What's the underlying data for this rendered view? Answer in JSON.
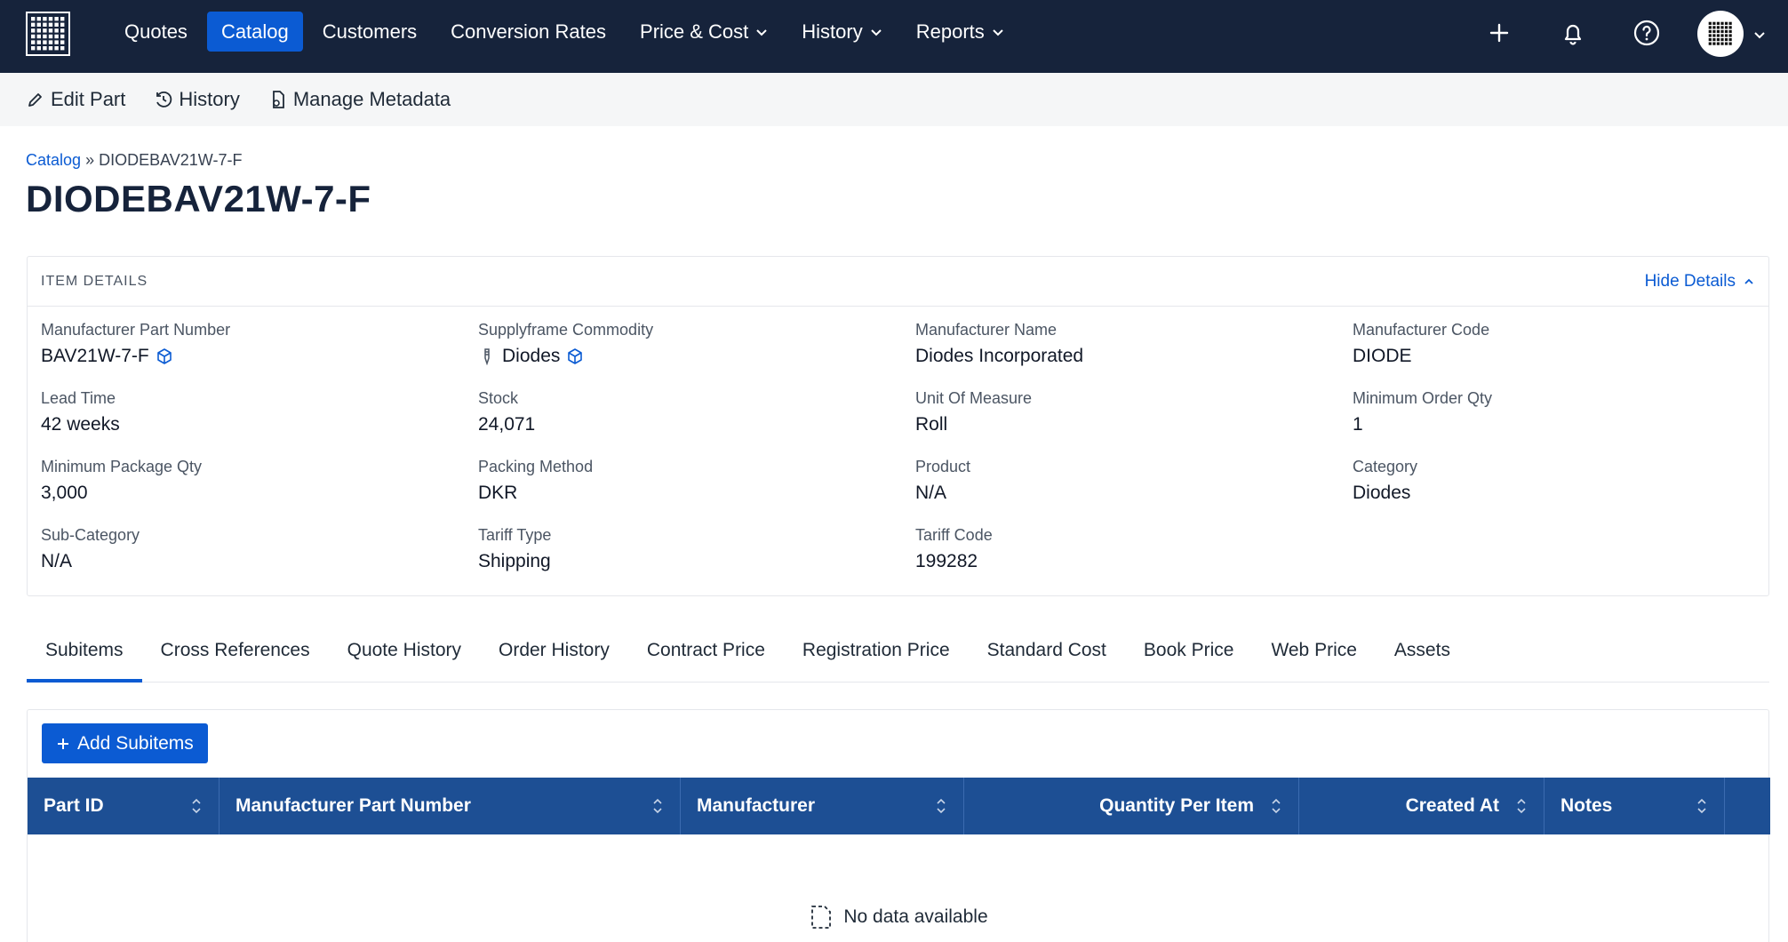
{
  "nav": {
    "items": [
      {
        "label": "Quotes",
        "active": false,
        "dropdown": false
      },
      {
        "label": "Catalog",
        "active": true,
        "dropdown": false
      },
      {
        "label": "Customers",
        "active": false,
        "dropdown": false
      },
      {
        "label": "Conversion Rates",
        "active": false,
        "dropdown": false
      },
      {
        "label": "Price & Cost",
        "active": false,
        "dropdown": true
      },
      {
        "label": "History",
        "active": false,
        "dropdown": true
      },
      {
        "label": "Reports",
        "active": false,
        "dropdown": true
      }
    ],
    "icons": [
      "plus-icon",
      "bell-icon",
      "help-icon",
      "avatar"
    ]
  },
  "toolbar": {
    "edit_label": "Edit Part",
    "history_label": "History",
    "metadata_label": "Manage Metadata"
  },
  "breadcrumb": {
    "root": "Catalog",
    "sep": "»",
    "current": "DIODEBAV21W-7-F"
  },
  "page": {
    "title": "DIODEBAV21W-7-F"
  },
  "details": {
    "header": "ITEM DETAILS",
    "hide_label": "Hide Details",
    "fields": [
      {
        "key": "Manufacturer Part Number",
        "value": "BAV21W-7-F",
        "icon_after": "cube-icon"
      },
      {
        "key": "Supplyframe Commodity",
        "value": "Diodes",
        "icon_before": "component-icon",
        "icon_after": "cube-icon"
      },
      {
        "key": "Manufacturer Name",
        "value": "Diodes Incorporated"
      },
      {
        "key": "Manufacturer Code",
        "value": "DIODE"
      },
      {
        "key": "Lead Time",
        "value": "42 weeks"
      },
      {
        "key": "Stock",
        "value": "24,071"
      },
      {
        "key": "Unit Of Measure",
        "value": "Roll"
      },
      {
        "key": "Minimum Order Qty",
        "value": "1"
      },
      {
        "key": "Minimum Package Qty",
        "value": "3,000"
      },
      {
        "key": "Packing Method",
        "value": "DKR"
      },
      {
        "key": "Product",
        "value": "N/A"
      },
      {
        "key": "Category",
        "value": "Diodes"
      },
      {
        "key": "Sub-Category",
        "value": "N/A"
      },
      {
        "key": "Tariff Type",
        "value": "Shipping"
      },
      {
        "key": "Tariff Code",
        "value": "199282"
      }
    ]
  },
  "tabs": [
    {
      "label": "Subitems",
      "active": true
    },
    {
      "label": "Cross References",
      "active": false
    },
    {
      "label": "Quote History",
      "active": false
    },
    {
      "label": "Order History",
      "active": false
    },
    {
      "label": "Contract Price",
      "active": false
    },
    {
      "label": "Registration Price",
      "active": false
    },
    {
      "label": "Standard Cost",
      "active": false
    },
    {
      "label": "Book Price",
      "active": false
    },
    {
      "label": "Web Price",
      "active": false
    },
    {
      "label": "Assets",
      "active": false
    }
  ],
  "subitems": {
    "add_label": "Add Subitems",
    "columns": [
      {
        "label": "Part ID",
        "align": "left"
      },
      {
        "label": "Manufacturer Part Number",
        "align": "left"
      },
      {
        "label": "Manufacturer",
        "align": "left"
      },
      {
        "label": "Quantity Per Item",
        "align": "right"
      },
      {
        "label": "Created At",
        "align": "right"
      },
      {
        "label": "Notes",
        "align": "left"
      },
      {
        "label": "",
        "align": "left"
      }
    ],
    "empty_text": "No data available"
  },
  "colors": {
    "nav_bg": "#16233b",
    "accent": "#0b5bd3",
    "table_header": "#1d4f94"
  }
}
